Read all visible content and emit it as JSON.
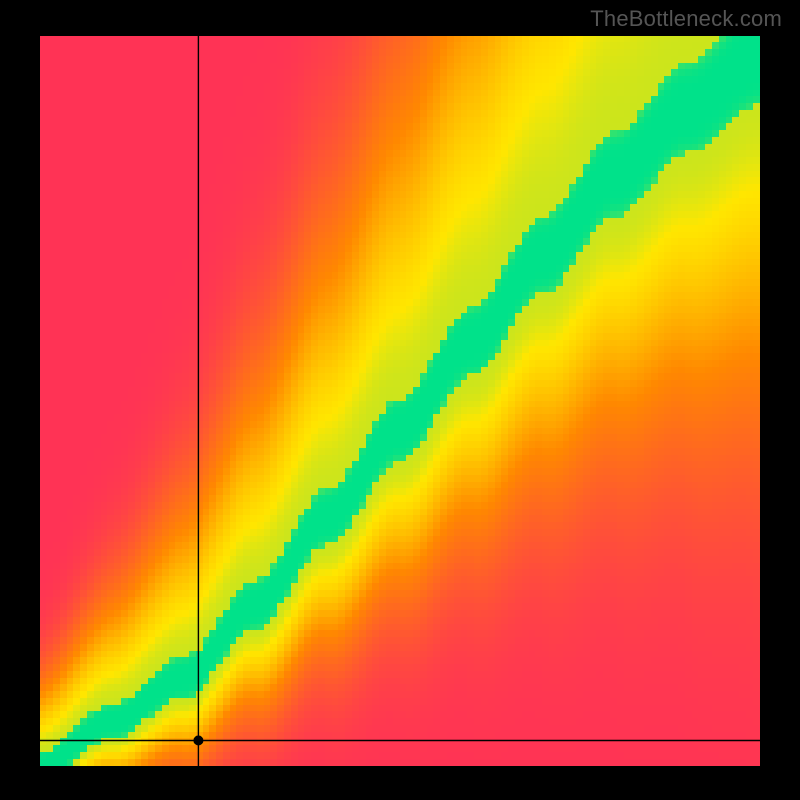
{
  "watermark": "TheBottleneck.com",
  "chart_data": {
    "type": "heatmap",
    "title": "",
    "xlabel": "",
    "ylabel": "",
    "xlim": [
      0,
      100
    ],
    "ylim": [
      0,
      100
    ],
    "grid": false,
    "legend": false,
    "colors": {
      "low": "#ff3355",
      "mid_low": "#ff8800",
      "mid": "#ffe600",
      "high": "#00e28a"
    },
    "ridge": {
      "description": "Green optimal band along y ≈ f(x) with slight S-curve; band widens with x.",
      "control_points": [
        {
          "x": 0,
          "y": 0
        },
        {
          "x": 10,
          "y": 6
        },
        {
          "x": 20,
          "y": 12
        },
        {
          "x": 30,
          "y": 22
        },
        {
          "x": 40,
          "y": 34
        },
        {
          "x": 50,
          "y": 46
        },
        {
          "x": 60,
          "y": 58
        },
        {
          "x": 70,
          "y": 70
        },
        {
          "x": 80,
          "y": 81
        },
        {
          "x": 90,
          "y": 90
        },
        {
          "x": 100,
          "y": 97
        }
      ],
      "band_half_width_at_0": 2,
      "band_half_width_at_100": 7
    },
    "crosshair": {
      "x": 22,
      "y": 3.5,
      "marker": "dot"
    },
    "resolution": {
      "cols": 106,
      "rows": 108
    }
  }
}
